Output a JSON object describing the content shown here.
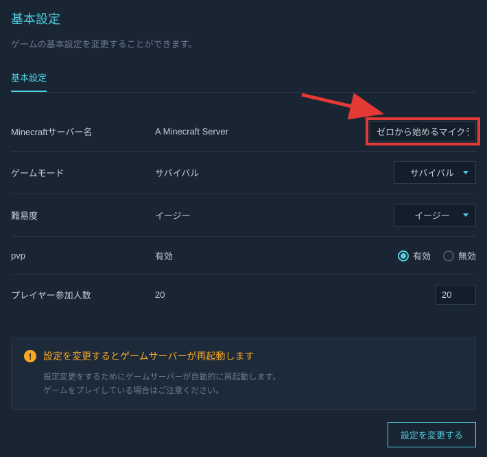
{
  "header": {
    "title": "基本設定",
    "subtitle": "ゲームの基本設定を変更することができます。"
  },
  "tabs": {
    "active": "基本設定"
  },
  "settings": {
    "server_name": {
      "label": "Minecraftサーバー名",
      "current": "A Minecraft Server",
      "input_value": "ゼロから始めるマイクラサ"
    },
    "game_mode": {
      "label": "ゲームモード",
      "current": "サバイバル",
      "selected": "サバイバル"
    },
    "difficulty": {
      "label": "難易度",
      "current": "イージー",
      "selected": "イージー"
    },
    "pvp": {
      "label": "pvp",
      "current": "有効",
      "options": {
        "enabled": "有効",
        "disabled": "無効"
      },
      "selected": "enabled"
    },
    "player_count": {
      "label": "プレイヤー参加人数",
      "current": "20",
      "input_value": "20"
    }
  },
  "warning": {
    "title": "設定を変更するとゲームサーバーが再起動します",
    "body_line1": "設定変更をするためにゲームサーバーが自動的に再起動します。",
    "body_line2": "ゲームをプレイしている場合はご注意ください。"
  },
  "actions": {
    "submit": "設定を変更する"
  }
}
